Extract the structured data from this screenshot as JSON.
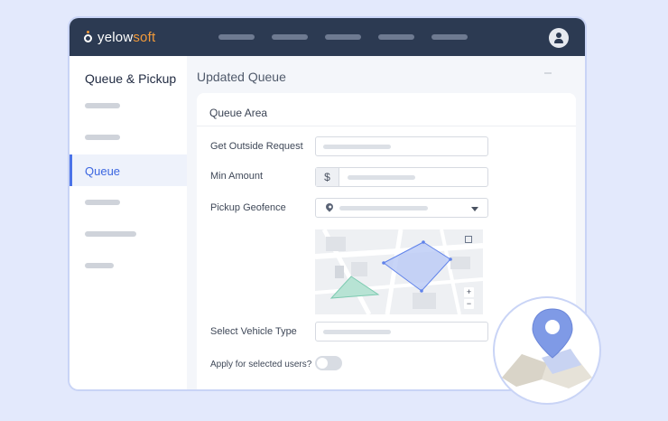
{
  "brand": {
    "name_plain": "yelow",
    "name_accent": "soft",
    "accent_color": "#f29a3a",
    "nav_bg": "#2c3a52"
  },
  "topbar": {
    "avatar_icon": "user-icon"
  },
  "sidebar": {
    "title": "Queue & Pickup",
    "active_item": "Queue",
    "active_color": "#3b66e0"
  },
  "main": {
    "title": "Updated Queue"
  },
  "panel": {
    "heading": "Queue Area",
    "fields": {
      "outside_request_label": "Get Outside Request",
      "min_amount_label": "Min Amount",
      "currency_symbol": "$",
      "geofence_label": "Pickup Geofence",
      "geofence_icon": "map-pin-icon",
      "vehicle_type_label": "Select Vehicle Type",
      "selected_users_label": "Apply for selected users?",
      "selected_users_toggle": false
    },
    "map": {
      "zoom_in": "+",
      "zoom_out": "−",
      "fullscreen_icon": "expand-icon"
    }
  },
  "decoration": {
    "badge_icon": "map-location-icon"
  }
}
